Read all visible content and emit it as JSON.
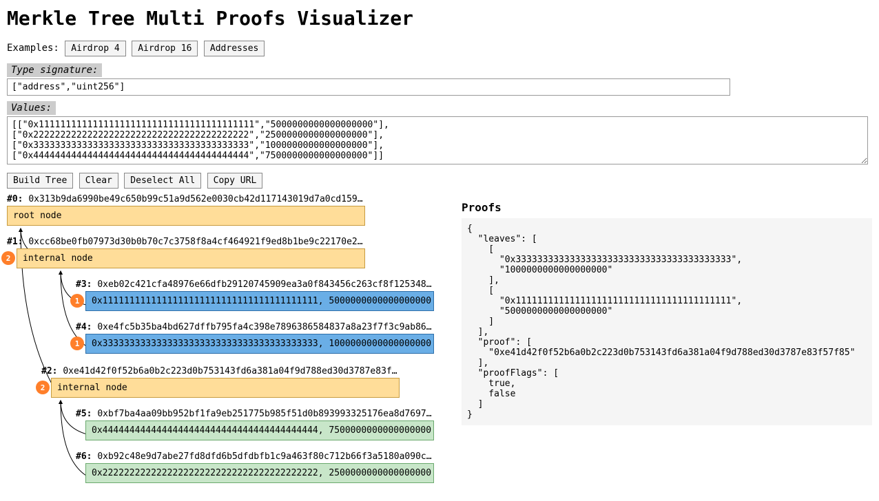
{
  "title": "Merkle Tree Multi Proofs Visualizer",
  "examples_label": "Examples:",
  "example_buttons": [
    "Airdrop 4",
    "Airdrop 16",
    "Addresses"
  ],
  "type_sig_label": "Type signature:",
  "type_sig_value": "[\"address\",\"uint256\"]",
  "values_label": "Values:",
  "values_text": "[[\"0x1111111111111111111111111111111111111111\",\"5000000000000000000\"],\n[\"0x2222222222222222222222222222222222222222\",\"2500000000000000000\"],\n[\"0x3333333333333333333333333333333333333333\",\"1000000000000000000\"],\n[\"0x4444444444444444444444444444444444444444\",\"7500000000000000000\"]]",
  "action_buttons": [
    "Build Tree",
    "Clear",
    "Deselect All",
    "Copy URL"
  ],
  "tree": {
    "n0": {
      "label": "#0:",
      "hash": "0x313b9da6990be49c650b99c51a9d562e0030cb42d117143019d7a0cd159…",
      "box": "root node"
    },
    "n1": {
      "label": "#1:",
      "hash": "0xcc68be0fb07973d30b0b70c7c3758f8a4cf464921f9ed8b1be9c22170e2…",
      "box": "internal node",
      "badge": "2"
    },
    "n2": {
      "label": "#2:",
      "hash": "0xe41d42f0f52b6a0b2c223d0b753143fd6a381a04f9d788ed30d3787e83f…",
      "box": "internal node",
      "badge": "2"
    },
    "n3": {
      "label": "#3:",
      "hash": "0xeb02c421cfa48976e66dfb29120745909ea3a0f843456c263cf8f125348…",
      "box": "0x1111111111111111111111111111111111111111, 5000000000000000000",
      "badge": "1"
    },
    "n4": {
      "label": "#4:",
      "hash": "0xe4fc5b35ba4bd627dffb795fa4c398e7896386584837a8a23f7f3c9ab86…",
      "box": "0x3333333333333333333333333333333333333333, 1000000000000000000",
      "badge": "1"
    },
    "n5": {
      "label": "#5:",
      "hash": "0xbf7ba4aa09bb952bf1fa9eb251775b985f51d0b893993325176ea8d7697…",
      "box": "0x4444444444444444444444444444444444444444, 7500000000000000000"
    },
    "n6": {
      "label": "#6:",
      "hash": "0xb92c48e9d7abe27fd8dfd6b5dfdbfb1c9a463f80c712b66f3a5180a090c…",
      "box": "0x2222222222222222222222222222222222222222, 2500000000000000000"
    }
  },
  "proofs_heading": "Proofs",
  "proofs_text": "{\n  \"leaves\": [\n    [\n      \"0x3333333333333333333333333333333333333333\",\n      \"1000000000000000000\"\n    ],\n    [\n      \"0x1111111111111111111111111111111111111111\",\n      \"5000000000000000000\"\n    ]\n  ],\n  \"proof\": [\n    \"0xe41d42f0f52b6a0b2c223d0b753143fd6a381a04f9d788ed30d3787e83f57f85\"\n  ],\n  \"proofFlags\": [\n    true,\n    false\n  ]\n}"
}
